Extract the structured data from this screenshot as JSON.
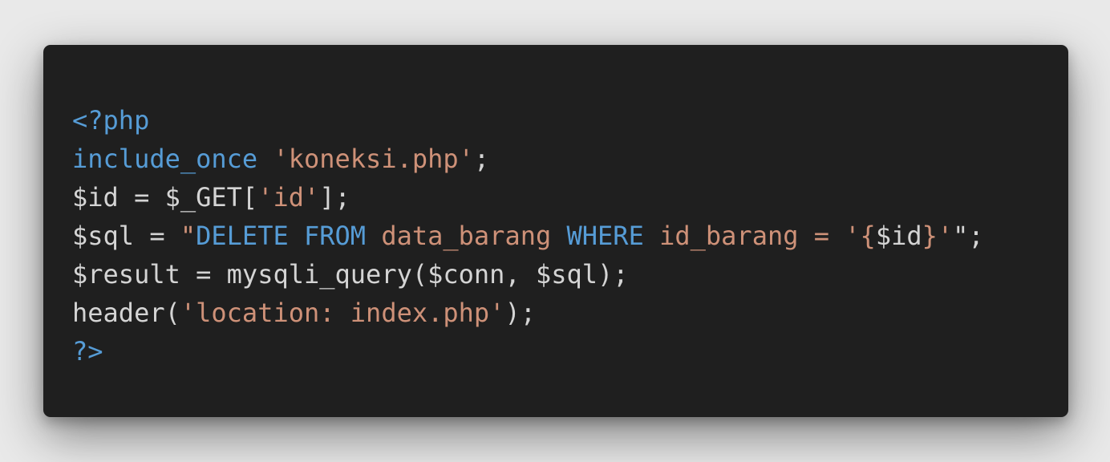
{
  "colors": {
    "background": "#e9e9e9",
    "editor_background": "#1f1f1f",
    "plain": "#d4d4d4",
    "keyword": "#569cd6",
    "string": "#ce9178"
  },
  "code": {
    "language": "php",
    "lines": [
      [
        {
          "text": "<?php",
          "kind": "kw"
        }
      ],
      [
        {
          "text": "include_once",
          "kind": "kw"
        },
        {
          "text": " ",
          "kind": "plain"
        },
        {
          "text": "'koneksi.php'",
          "kind": "str"
        },
        {
          "text": ";",
          "kind": "plain"
        }
      ],
      [
        {
          "text": "$id = $_GET[",
          "kind": "plain"
        },
        {
          "text": "'id'",
          "kind": "str"
        },
        {
          "text": "];",
          "kind": "plain"
        }
      ],
      [
        {
          "text": "$sql = ",
          "kind": "plain"
        },
        {
          "text": "\"",
          "kind": "str"
        },
        {
          "text": "DELETE FROM",
          "kind": "kw"
        },
        {
          "text": " data_barang ",
          "kind": "str"
        },
        {
          "text": "WHERE",
          "kind": "kw"
        },
        {
          "text": " id_barang = '{",
          "kind": "str"
        },
        {
          "text": "$id",
          "kind": "plain"
        },
        {
          "text": "}'",
          "kind": "str"
        },
        {
          "text": "\"",
          "kind": "plain"
        },
        {
          "text": ";",
          "kind": "plain"
        }
      ],
      [
        {
          "text": "$result = mysqli_query($conn, $sql);",
          "kind": "plain"
        }
      ],
      [
        {
          "text": "header(",
          "kind": "plain"
        },
        {
          "text": "'location: index.php'",
          "kind": "str"
        },
        {
          "text": ");",
          "kind": "plain"
        }
      ],
      [
        {
          "text": "?>",
          "kind": "kw"
        }
      ]
    ]
  }
}
